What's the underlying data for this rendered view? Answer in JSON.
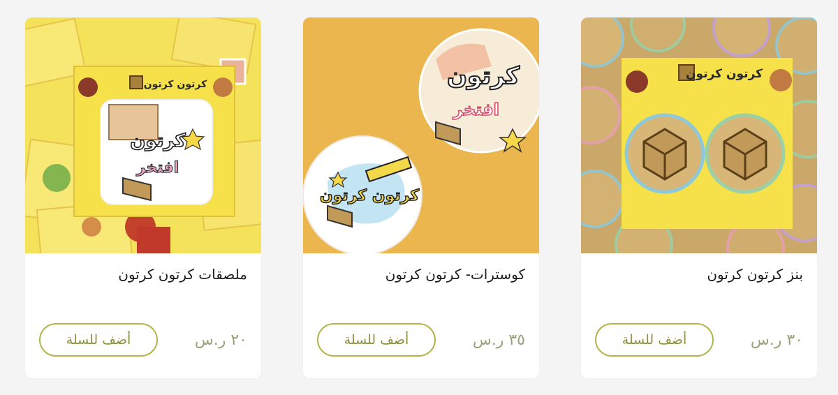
{
  "products": [
    {
      "title": "بنز كرتون كرتون",
      "price": "٣٠ ر.س",
      "button": "أضف للسلة",
      "image": "product-image-pins",
      "brand_text": "كرتون كرتون"
    },
    {
      "title": "كوسترات- كرتون كرتون",
      "price": "٣٥ ر.س",
      "button": "أضف للسلة",
      "image": "product-image-coasters",
      "coaster_1_text": "كرتون",
      "coaster_1_sub": "افتخر",
      "coaster_2_text": "كرتون كرتون"
    },
    {
      "title": "ملصقات كرتون كرتون",
      "price": "٢٠ ر.س",
      "button": "أضف للسلة",
      "image": "product-image-stickers",
      "brand_text": "كرتون كرتون",
      "sticker_text": "كرتون",
      "sticker_sub": "افتخر"
    }
  ],
  "colors": {
    "accent": "#b3b44c",
    "price": "#9aa07a",
    "yellow": "#f6e14a",
    "card_bg": "#ffffff",
    "page_bg": "#f4f4f4"
  }
}
